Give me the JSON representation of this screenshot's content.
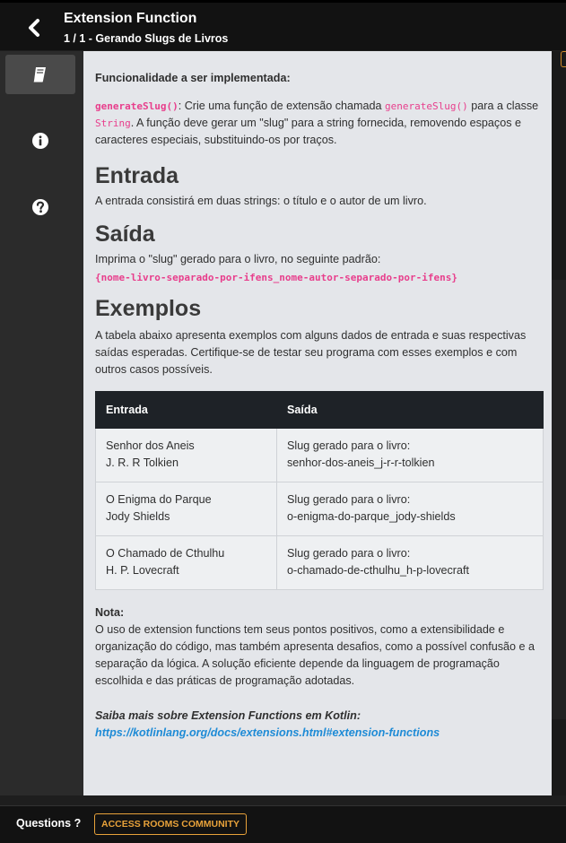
{
  "header": {
    "title": "Extension Function",
    "subtitle": "1 / 1 - Gerando Slugs de Livros"
  },
  "sidebar": {
    "items": [
      {
        "icon": "book-icon",
        "active": true
      },
      {
        "icon": "info-icon",
        "active": false
      },
      {
        "icon": "help-icon",
        "active": false
      }
    ]
  },
  "content": {
    "lead": "Funcionalidade a ser implementada:",
    "intro": {
      "code1": "generateSlug()",
      "t1": ": Crie uma função de extensão chamada ",
      "code2": "generateSlug()",
      "t2": " para a classe ",
      "code3": "String",
      "t3": ". A função deve gerar um \"slug\" para a string fornecida, removendo espaços e caracteres especiais, substituindo-os por traços."
    },
    "entrada_title": "Entrada",
    "entrada_text": "A entrada consistirá em duas strings: o título e o autor de um livro.",
    "saida_title": "Saída",
    "saida_text": "Imprima o \"slug\" gerado para o livro, no seguinte padrão:",
    "saida_pattern": "{nome-livro-separado-por-ifens_nome-autor-separado-por-ifens}",
    "exemplos_title": "Exemplos",
    "exemplos_text": "A tabela abaixo apresenta exemplos com alguns dados de entrada e suas respectivas saídas esperadas. Certifique-se de testar seu programa com esses exemplos e com outros casos possíveis.",
    "table": {
      "headers": [
        "Entrada",
        "Saída"
      ],
      "rows": [
        {
          "in1": "Senhor dos Aneis",
          "in2": "J. R. R Tolkien",
          "out1": "Slug gerado para o livro:",
          "out2": "senhor-dos-aneis_j-r-r-tolkien"
        },
        {
          "in1": "O Enigma do Parque",
          "in2": "Jody Shields",
          "out1": "Slug gerado para o livro:",
          "out2": "o-enigma-do-parque_jody-shields"
        },
        {
          "in1": "O Chamado de Cthulhu",
          "in2": "H. P. Lovecraft",
          "out1": "Slug gerado para o livro:",
          "out2": "o-chamado-de-cthulhu_h-p-lovecraft"
        }
      ]
    },
    "nota_title": "Nota:",
    "nota_text": "O uso de extension functions tem seus pontos positivos, como a extensibilidade e organização do código, mas também apresenta desafios, como a possível confusão e a separação da lógica. A solução eficiente depende da linguagem de programação escolhida e das práticas de programação adotadas.",
    "saiba_text": "Saiba mais sobre Extension Functions em Kotlin:",
    "saiba_link": "https://kotlinlang.org/docs/extensions.html#extension-functions"
  },
  "footer": {
    "questions": "Questions ?",
    "access_button": "ACCESS ROOMS COMMUNITY"
  },
  "colors": {
    "accent": "#e8a23a",
    "code": "#e83e8c",
    "link": "#1e8bd6"
  }
}
